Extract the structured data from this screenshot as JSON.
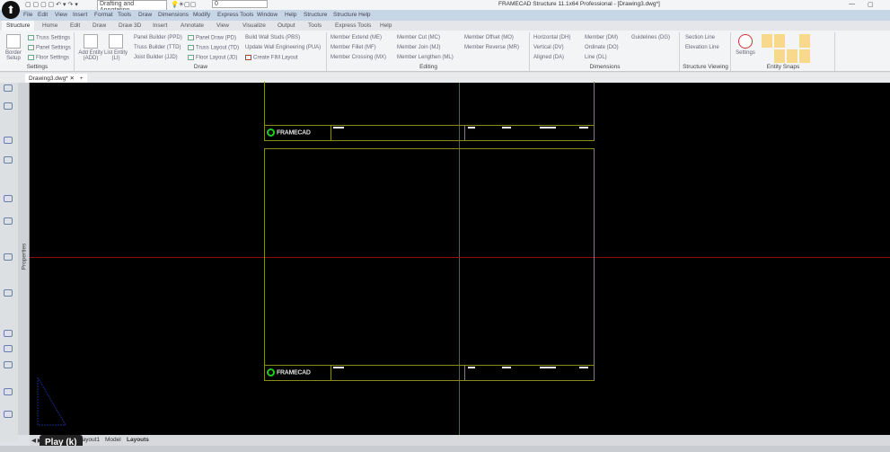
{
  "window": {
    "title": "FRAMECAD Structure 11.1x64 Professional - [Drawing3.dwg*]",
    "workspace": "Drafting and Annotation",
    "layer": "0"
  },
  "menu": [
    "File",
    "Edit",
    "View",
    "Insert",
    "Format",
    "Tools",
    "Draw",
    "Dimensions",
    "Modify",
    "Express Tools",
    "Window",
    "Help",
    "Structure",
    "Structure Help"
  ],
  "tabs": [
    "Structure",
    "Home",
    "Edit",
    "Draw",
    "Draw 3D",
    "Insert",
    "Annotate",
    "View",
    "Visualize",
    "Output",
    "Tools",
    "Express Tools",
    "Help"
  ],
  "ribbon": {
    "settings": {
      "label": "Settings",
      "border_setup": "Border Setup",
      "items": [
        "Truss Settings",
        "Panel Settings",
        "Floor Settings"
      ]
    },
    "draw": {
      "label": "Draw",
      "add_entity": "Add Entity (ADD)",
      "list_entity": "List Entity (LI)",
      "col1": [
        "Panel Builder (PPD)",
        "Truss Builder (TTD)",
        "Joist Builder (JJD)"
      ],
      "col2": [
        "Panel Draw (PD)",
        "Truss Layout (TD)",
        "Floor Layout (JD)"
      ],
      "col3": [
        "Build Wall Studs (PBS)",
        "Update Wall Engineering (PUA)",
        "Create FIM Layout"
      ]
    },
    "editing": {
      "label": "Editing",
      "col1": [
        "Member Extend (ME)",
        "Member Fillet (MF)",
        "Member Crossing (MX)"
      ],
      "col2": [
        "Member Cut (MC)",
        "Member Join (MJ)",
        "Member Lengthen (ML)"
      ],
      "col3": [
        "Member Offset (MO)",
        "Member Reverse (MR)"
      ]
    },
    "dimensions": {
      "label": "Dimensions",
      "col1": [
        "Horizontal (DH)",
        "Vertical (DV)",
        "Aligned (DA)"
      ],
      "col2": [
        "Member (DM)",
        "Ordinate (DO)",
        "Line (DL)"
      ],
      "col3": [
        "Guidelines (DG)"
      ]
    },
    "structure_viewing": {
      "label": "Structure Viewing",
      "items": [
        "Section Line",
        "Elevation Line"
      ]
    },
    "entity_snaps": {
      "label": "Entity Snaps",
      "settings": "Settings"
    }
  },
  "document_tab": "Drawing3.dwg*",
  "properties_label": "Properties",
  "title_block_logo": "FRAMECAD",
  "layout_tabs": [
    "Layout1",
    "Model",
    "Layouts"
  ],
  "tooltip": "Play (k)",
  "colors": {
    "canvas": "#000000",
    "crosshair_v": "#2e7d2e",
    "crosshair_h": "#8b1010",
    "border": "#8a8a1e"
  }
}
